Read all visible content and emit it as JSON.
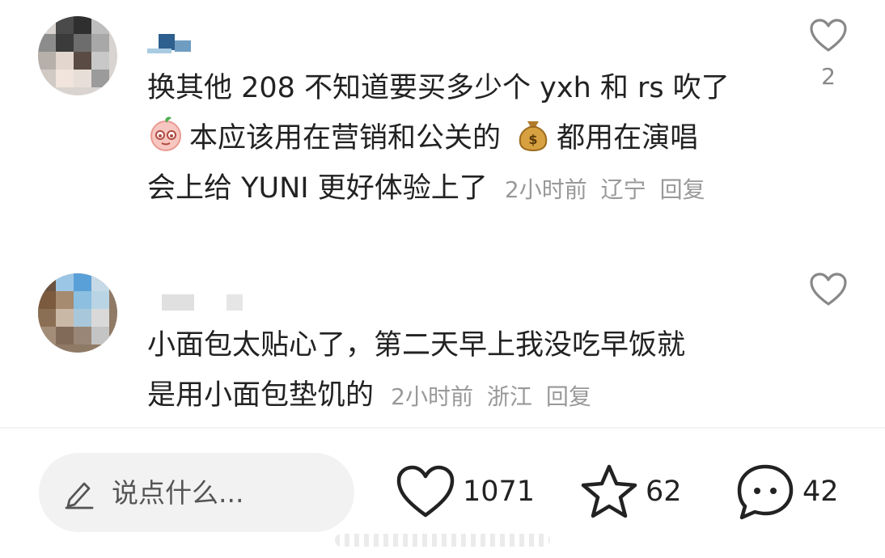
{
  "comments": [
    {
      "lines": [
        "换其他 208 不知道要买多少个 yxh 和 rs 吹了",
        "本应该用在营销和公关的",
        "都用在演唱",
        "会上给 YUNI 更好体验上了"
      ],
      "emojis": [
        "shy-face-emoji",
        "money-bag-emoji"
      ],
      "time": "2小时前",
      "location": "辽宁",
      "reply_label": "回复",
      "like_count": "2"
    },
    {
      "lines": [
        "小面包太贴心了，第二天早上我没吃早饭就",
        "是用小面包垫饥的"
      ],
      "time": "2小时前",
      "location": "浙江",
      "reply_label": "回复",
      "like_count": ""
    }
  ],
  "bottom_bar": {
    "input_placeholder": "说点什么...",
    "likes": "1071",
    "favorites": "62",
    "comments": "42"
  },
  "colors": {
    "text": "#222222",
    "meta": "#999999",
    "input_bg": "#f2f2f2"
  }
}
